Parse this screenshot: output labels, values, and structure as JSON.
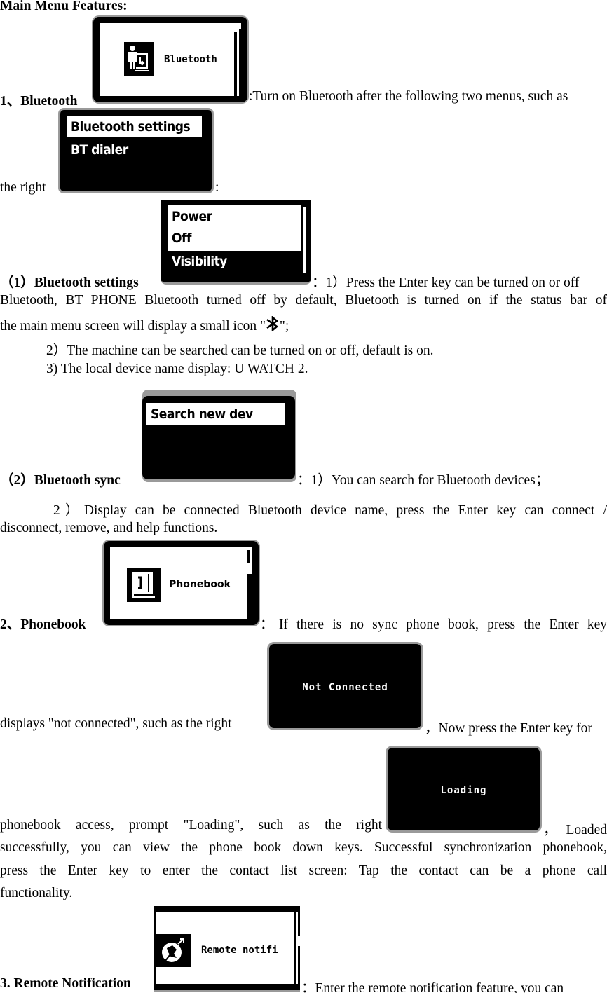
{
  "heading": "Main Menu Features:",
  "section1": {
    "title": "1、Bluetooth",
    "screen_label": "Bluetooth",
    "desc_line1": ":Turn on Bluetooth after the following two menus, such as",
    "desc_line2_prefix": "the right",
    "desc_line2_suffix": ":",
    "submenu_screen": {
      "items": [
        "Bluetooth settings",
        "BT dialer"
      ],
      "selected": "Bluetooth settings"
    }
  },
  "subsection1": {
    "title": "（1）Bluetooth settings",
    "screen": {
      "items": [
        "Power",
        "Off",
        "Visibility"
      ],
      "selected": "Visibility"
    },
    "line1": "：1）Press the Enter key can be turned on or off",
    "line2": "Bluetooth, BT PHONE Bluetooth turned off by default, Bluetooth is turned on if the status bar of",
    "line3_prefix": "the main menu screen will display a small icon \"",
    "line3_icon": "bluetooth-icon",
    "line3_suffix": "\";",
    "line4": "2）The machine can be searched can be turned on or off, default is on.",
    "line5": "3) The local device name display: U WATCH 2."
  },
  "subsection2": {
    "title": "（2）Bluetooth sync",
    "screen": {
      "items": [
        "Search new dev"
      ],
      "selected": "Search new dev"
    },
    "line1": "：1）You can search for Bluetooth devices；",
    "line2": "2）Display can be connected Bluetooth device name, press the Enter key can connect /",
    "line3": "disconnect, remove, and help functions."
  },
  "section2": {
    "title": "2、Phonebook",
    "screen_label": "Phonebook",
    "line1": "：If there is no sync phone book, press the Enter key",
    "line2": "displays \"not connected\", such as the right",
    "not_connected_screen": "Not Connected",
    "line2_suffix": "，Now press the Enter key for",
    "line3": "phonebook access, prompt \"Loading\", such as the right",
    "loading_screen": "Loading",
    "line3_suffix": "，Loaded",
    "line4": "successfully, you can view the phone book down keys. Successful synchronization phonebook,",
    "line5": "press the Enter key to enter the contact list screen: Tap the contact can be a phone call",
    "line6": "functionality."
  },
  "section3": {
    "title": "3. Remote Notification",
    "screen_label": "Remote notifi",
    "line1": "：Enter the remote notification feature, you can"
  }
}
